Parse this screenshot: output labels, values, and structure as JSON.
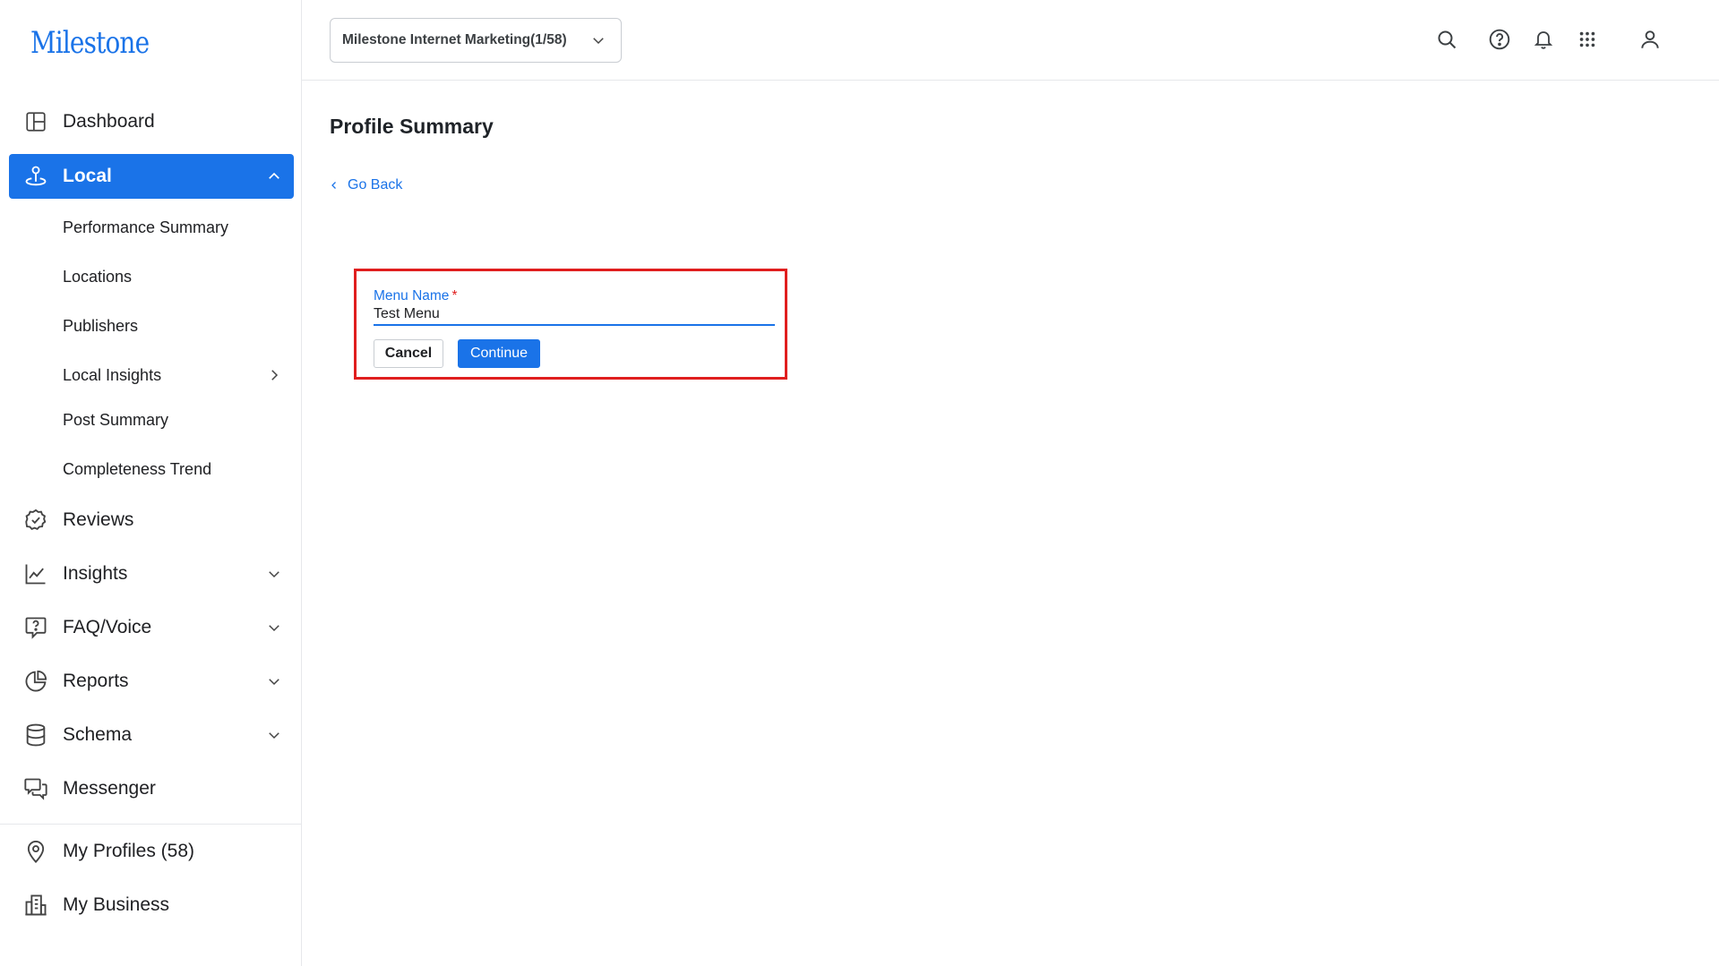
{
  "brand": {
    "logo_text": "Milestone"
  },
  "sidebar": {
    "dashboard": "Dashboard",
    "local": "Local",
    "local_sub": {
      "performance_summary": "Performance Summary",
      "locations": "Locations",
      "publishers": "Publishers",
      "local_insights": "Local Insights",
      "post_summary": "Post Summary",
      "completeness_trend": "Completeness Trend"
    },
    "reviews": "Reviews",
    "insights": "Insights",
    "faq_voice": "FAQ/Voice",
    "reports": "Reports",
    "schema": "Schema",
    "messenger": "Messenger",
    "my_profiles": "My Profiles (58)",
    "my_business": "My Business"
  },
  "header": {
    "account_select": "Milestone Internet Marketing(1/58)",
    "icons": [
      "search-icon",
      "help-icon",
      "bell-icon",
      "apps-grid-icon",
      "user-icon"
    ]
  },
  "main": {
    "title": "Profile Summary",
    "go_back": "Go Back",
    "form": {
      "label": "Menu Name",
      "required_mark": "*",
      "value": "Test Menu",
      "cancel": "Cancel",
      "continue": "Continue"
    }
  },
  "colors": {
    "accent": "#1a73e8",
    "highlight_border": "#e01e1e"
  }
}
